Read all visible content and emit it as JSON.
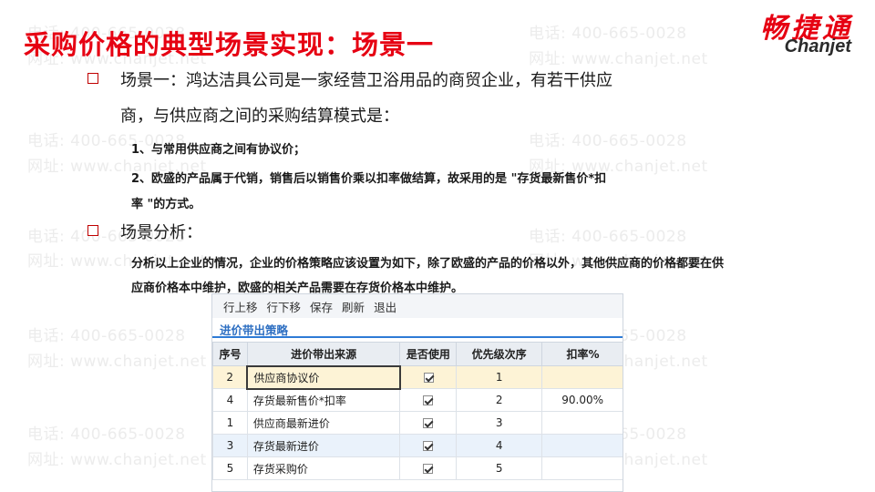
{
  "watermark": {
    "phone": "电话: 400-665-0028",
    "site": "网址: www.chanjet.net"
  },
  "title": "采购价格的典型场景实现：场景一",
  "logo": {
    "cn": "畅捷通",
    "en": "Chanjet"
  },
  "scene1": {
    "line1": "场景一：鸿达洁具公司是一家经营卫浴用品的商贸企业，有若干供应",
    "line2": "商，与供应商之间的采购结算模式是：",
    "item1": "1、与常用供应商之间有协议价；",
    "item2a": "2、欧盛的产品属于代销，销售后以销售价乘以扣率做结算，故采用的是 \"存货最新售价*扣",
    "item2b": "率 \"的方式。"
  },
  "scene2": {
    "heading": "场景分析：",
    "para1": "分析以上企业的情况，企业的价格策略应该设置为如下，除了欧盛的产品的价格以外，其他供应商的价格都要在供",
    "para2": "应商价格本中维护，欧盛的相关产品需要在存货价格本中维护。"
  },
  "erp": {
    "toolbar": [
      "行上移",
      "行下移",
      "保存",
      "刷新",
      "退出"
    ],
    "tab": "进价带出策略",
    "columns": [
      "序号",
      "进价带出来源",
      "是否使用",
      "优先级次序",
      "扣率%"
    ],
    "rows": [
      {
        "seq": "2",
        "source": "供应商协议价",
        "used": true,
        "priority": "1",
        "rate": ""
      },
      {
        "seq": "4",
        "source": "存货最新售价*扣率",
        "used": true,
        "priority": "2",
        "rate": "90.00%"
      },
      {
        "seq": "1",
        "source": "供应商最新进价",
        "used": true,
        "priority": "3",
        "rate": ""
      },
      {
        "seq": "3",
        "source": "存货最新进价",
        "used": true,
        "priority": "4",
        "rate": ""
      },
      {
        "seq": "5",
        "source": "存货采购价",
        "used": true,
        "priority": "5",
        "rate": ""
      }
    ]
  }
}
